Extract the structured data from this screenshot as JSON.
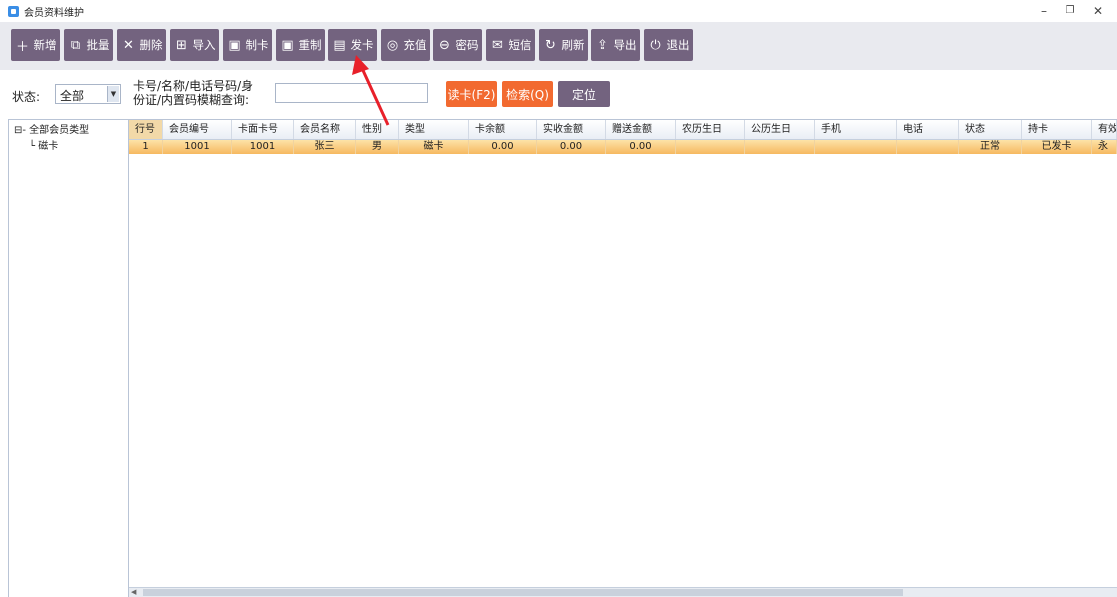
{
  "window": {
    "title": "会员资料维护",
    "minimize": "–",
    "restore": "❐",
    "close": "✕"
  },
  "toolbar": [
    {
      "label": "新增",
      "icon": "plus-icon",
      "glyph": "＋"
    },
    {
      "label": "批量",
      "icon": "batch-icon",
      "glyph": "⧉"
    },
    {
      "label": "删除",
      "icon": "delete-icon",
      "glyph": "✕"
    },
    {
      "label": "导入",
      "icon": "import-icon",
      "glyph": "⊞"
    },
    {
      "label": "制卡",
      "icon": "make-card-icon",
      "glyph": "▣"
    },
    {
      "label": "重制",
      "icon": "remake-card-icon",
      "glyph": "▣"
    },
    {
      "label": "发卡",
      "icon": "issue-card-icon",
      "glyph": "▤"
    },
    {
      "label": "充值",
      "icon": "recharge-icon",
      "glyph": "◎"
    },
    {
      "label": "密码",
      "icon": "lock-icon",
      "glyph": "⊖"
    },
    {
      "label": "短信",
      "icon": "message-icon",
      "glyph": "✉"
    },
    {
      "label": "刷新",
      "icon": "refresh-icon",
      "glyph": "↻"
    },
    {
      "label": "导出",
      "icon": "export-icon",
      "glyph": "⇪"
    },
    {
      "label": "退出",
      "icon": "power-icon",
      "glyph": "⏻"
    }
  ],
  "search": {
    "status_label": "状态:",
    "status_value": "全部",
    "query_label_line1": "卡号/名称/电话号码/身",
    "query_label_line2": "份证/内置码模糊查询:",
    "query_value": "",
    "read_card": "读卡(F2)",
    "search": "检索(Q)",
    "locate": "定位"
  },
  "tree": {
    "root": "⊟- 全部会员类型",
    "child": "└ 磁卡"
  },
  "grid": {
    "columns": [
      "行号",
      "会员编号",
      "卡面卡号",
      "会员名称",
      "性别",
      "类型",
      "卡余额",
      "实收金额",
      "赠送金额",
      "农历生日",
      "公历生日",
      "手机",
      "电话",
      "状态",
      "持卡",
      "有效"
    ],
    "rows": [
      [
        "1",
        "1001",
        "1001",
        "张三",
        "男",
        "磁卡",
        "0.00",
        "0.00",
        "0.00",
        "",
        "",
        "",
        "",
        "正常",
        "已发卡",
        "永"
      ]
    ]
  },
  "colors": {
    "toolbar_button": "#73637f",
    "accent_orange": "#f26a30",
    "row_selected": "#f6b860",
    "arrow": "#e8202a"
  }
}
